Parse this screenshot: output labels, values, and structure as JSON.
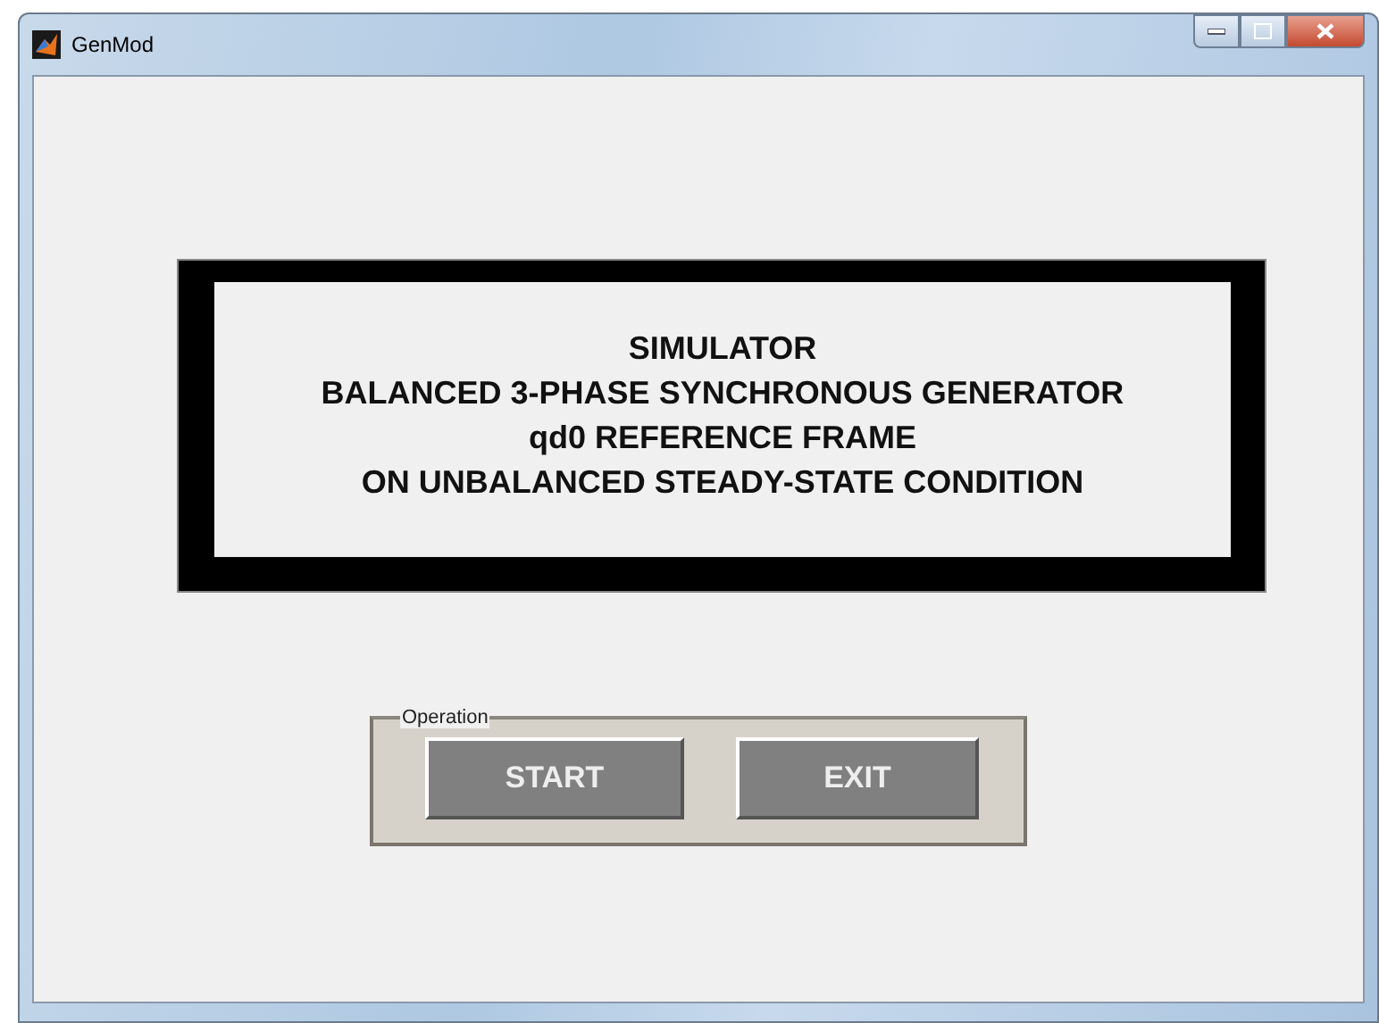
{
  "window": {
    "title": "GenMod"
  },
  "banner": {
    "lines": [
      "SIMULATOR",
      "BALANCED 3-PHASE SYNCHRONOUS GENERATOR",
      "qd0 REFERENCE FRAME",
      "ON UNBALANCED STEADY-STATE CONDITION"
    ]
  },
  "operation": {
    "legend": "Operation",
    "buttons": [
      "START",
      "EXIT"
    ]
  }
}
